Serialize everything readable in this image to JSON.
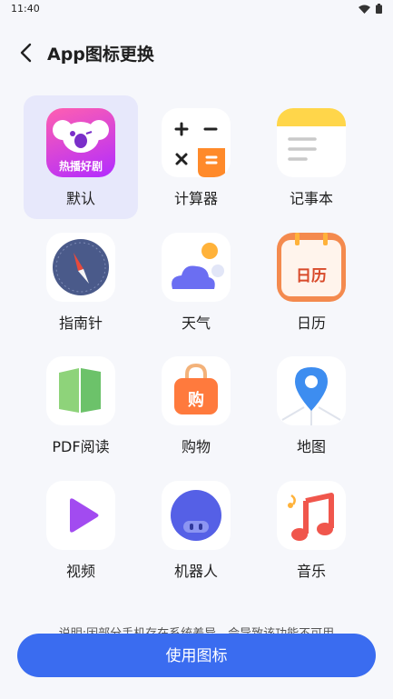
{
  "status_bar": {
    "time": "11:40"
  },
  "header": {
    "title": "App图标更换"
  },
  "icons": [
    {
      "label": "默认",
      "name": "koala-icon",
      "badge": "热播好剧",
      "selected": true
    },
    {
      "label": "计算器",
      "name": "calculator-icon"
    },
    {
      "label": "记事本",
      "name": "notepad-icon"
    },
    {
      "label": "指南针",
      "name": "compass-icon"
    },
    {
      "label": "天气",
      "name": "weather-icon"
    },
    {
      "label": "日历",
      "name": "calendar-icon",
      "badge": "日历"
    },
    {
      "label": "PDF阅读",
      "name": "pdf-reader-icon"
    },
    {
      "label": "购物",
      "name": "shopping-bag-icon",
      "badge": "购"
    },
    {
      "label": "地图",
      "name": "map-pin-icon"
    },
    {
      "label": "视频",
      "name": "video-play-icon"
    },
    {
      "label": "机器人",
      "name": "robot-icon"
    },
    {
      "label": "音乐",
      "name": "music-note-icon"
    }
  ],
  "note": "说明:因部分手机存在系统差异，会导致该功能不可用",
  "button": {
    "label": "使用图标"
  },
  "colors": {
    "accent": "#3a6cf0",
    "selected_bg": "#e7e8fb"
  }
}
